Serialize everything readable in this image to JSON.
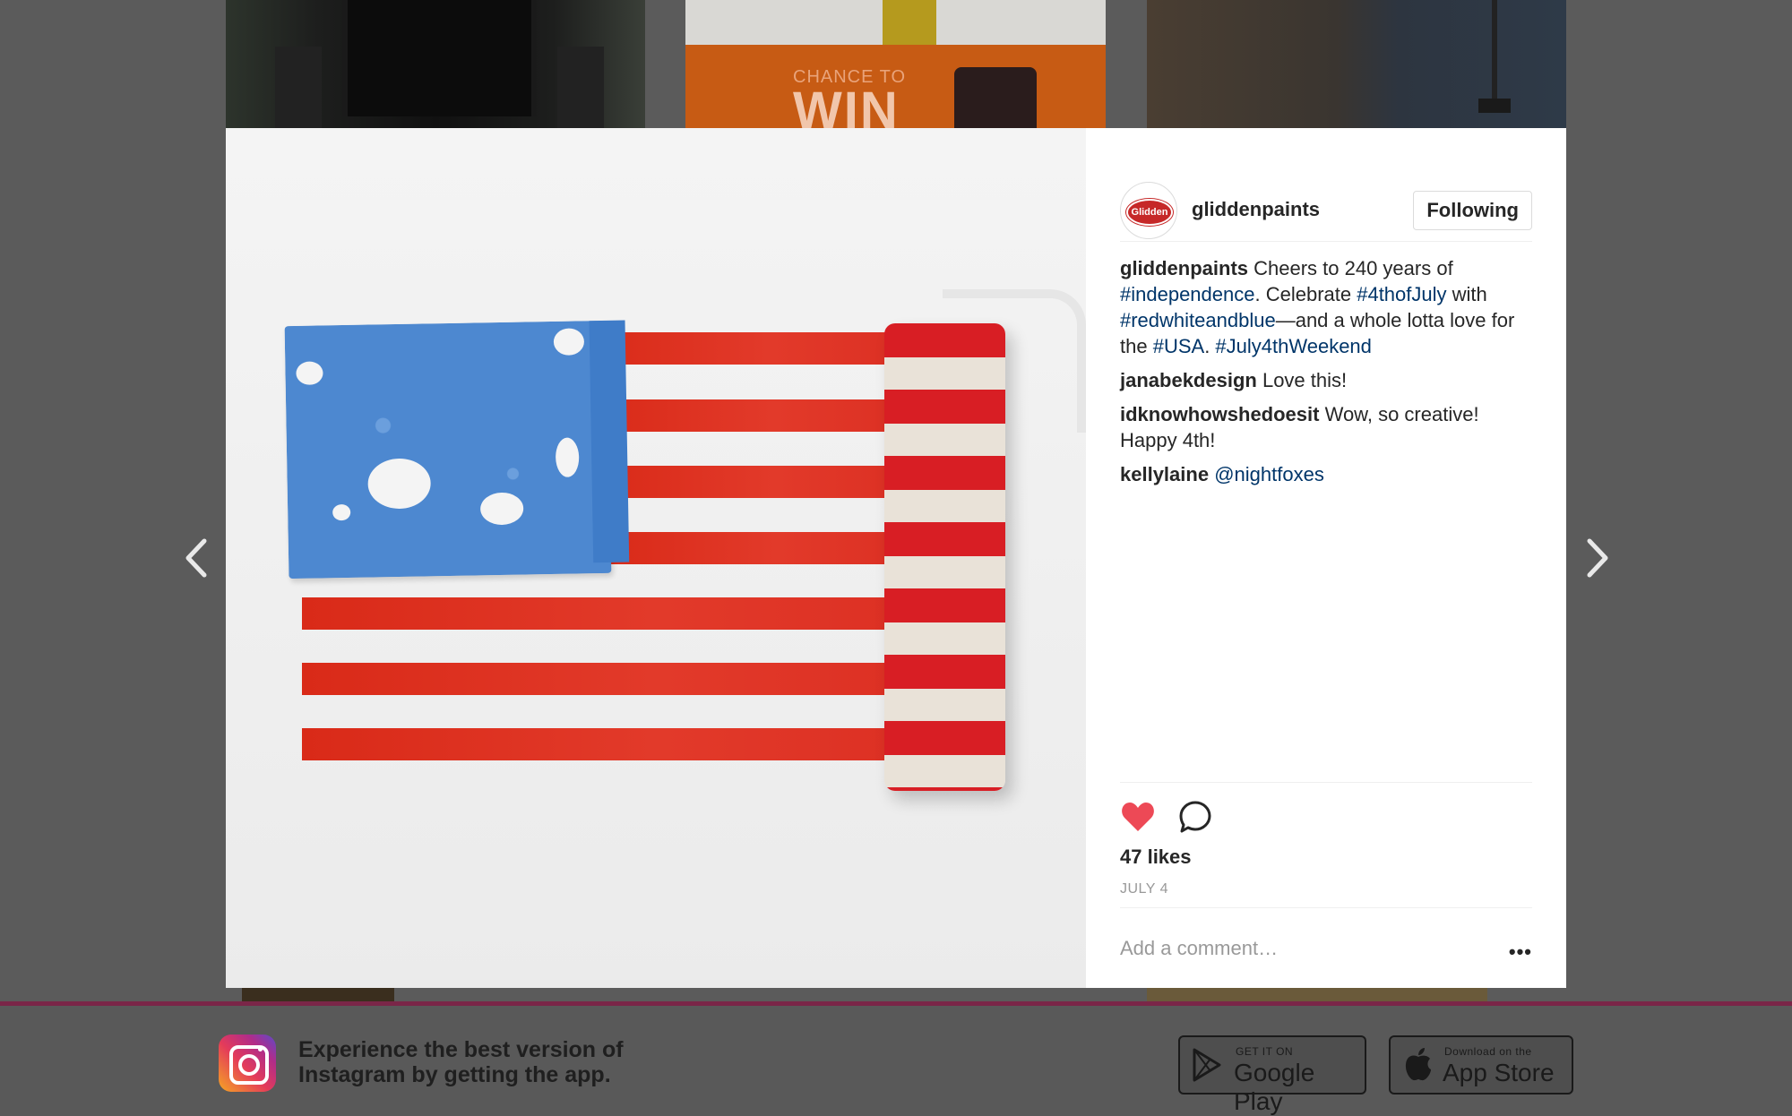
{
  "post": {
    "username": "gliddenpaints",
    "avatar_text": "Glidden",
    "follow_label": "Following",
    "caption": {
      "user": "gliddenpaints",
      "t1": " Cheers to 240 years of ",
      "h1": "#independence",
      "t2": ". Celebrate ",
      "h2": "#4thofJuly",
      "t3": " with ",
      "h3": "#redwhiteandblue",
      "t4": "—and a whole lotta love for the ",
      "h4": "#USA",
      "t5": ". ",
      "h5": "#July4thWeekend"
    },
    "comments": [
      {
        "user": "janabekdesign",
        "text": " Love this!"
      },
      {
        "user": "idknowhowshedoesit",
        "text": " Wow, so creative! Happy 4th!"
      },
      {
        "user": "kellylaine",
        "mention": "@nightfoxes"
      }
    ],
    "likes": "47 likes",
    "date": "JULY 4",
    "comment_placeholder": "Add a comment…",
    "more_label": "•••"
  },
  "background": {
    "promo_small": "CHANCE TO",
    "promo_big": "WIN"
  },
  "footer": {
    "promo_line1": "Experience the best version of",
    "promo_line2": "Instagram by getting the app.",
    "google_small": "GET IT ON",
    "google_big": "Google Play",
    "apple_small": "Download on the",
    "apple_big": "App Store"
  },
  "colors": {
    "like_heart": "#ed4956",
    "hashtag": "#003569"
  }
}
